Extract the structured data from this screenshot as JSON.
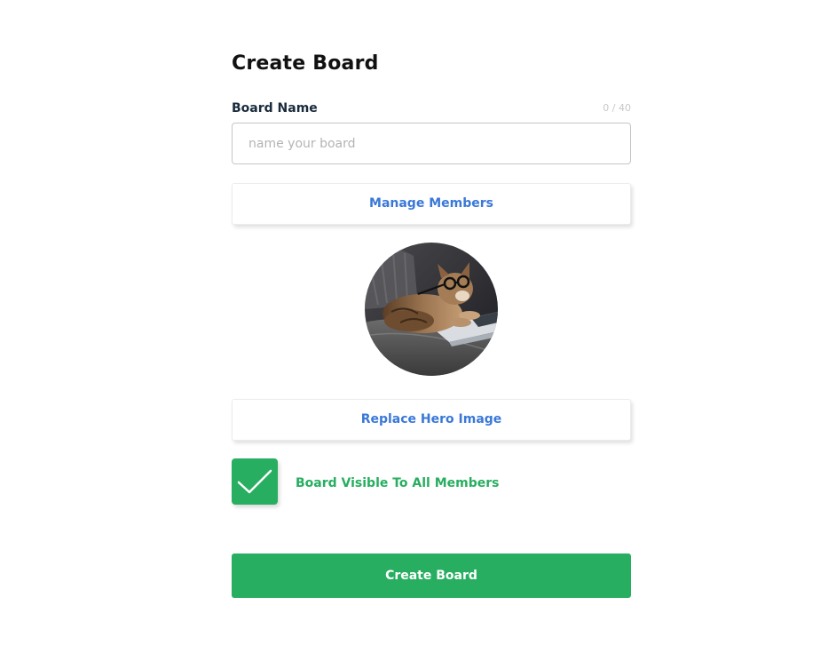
{
  "page": {
    "title": "Create Board"
  },
  "board_name": {
    "label": "Board Name",
    "char_count": "0 / 40",
    "value": "",
    "placeholder": "name your board"
  },
  "buttons": {
    "manage_members": "Manage Members",
    "replace_hero": "Replace Hero Image",
    "submit": "Create Board"
  },
  "visibility": {
    "label": "Board Visible To All Members",
    "checked": true,
    "icon": "checkmark-icon"
  },
  "hero_image": {
    "alt_icon": "cat-on-laptop-photo"
  },
  "colors": {
    "accent_blue": "#3a78d8",
    "success_green": "#27ae60",
    "title_text": "#111111"
  }
}
